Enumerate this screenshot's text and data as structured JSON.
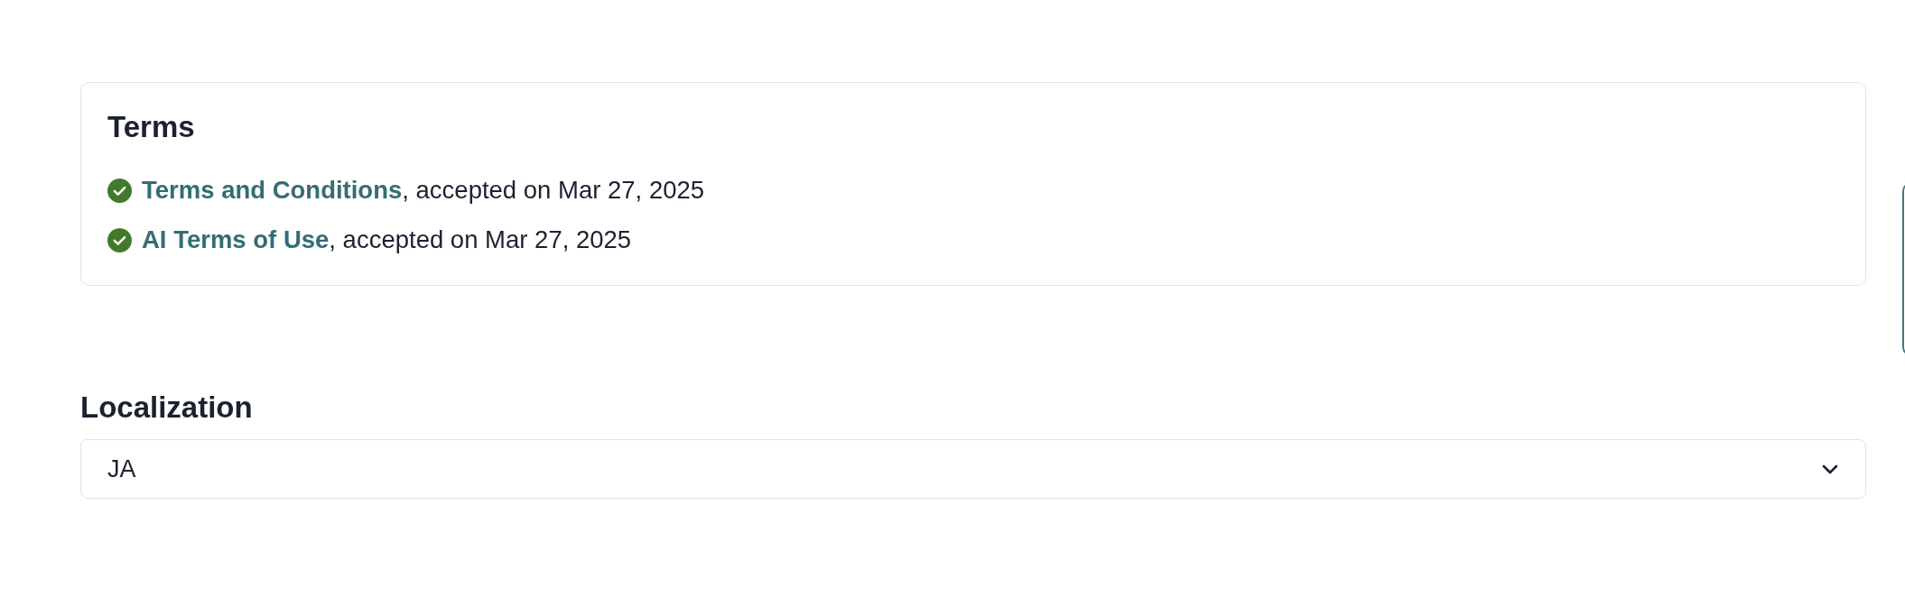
{
  "terms": {
    "title": "Terms",
    "items": [
      {
        "link": "Terms and Conditions",
        "text": ", accepted on Mar 27, 2025",
        "accepted": true
      },
      {
        "link": "AI Terms of Use",
        "text": ", accepted on Mar 27, 2025",
        "accepted": true
      }
    ]
  },
  "localization": {
    "label": "Localization",
    "select": {
      "value": "JA"
    }
  }
}
